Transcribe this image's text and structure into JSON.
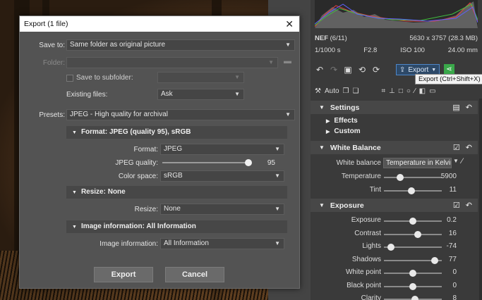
{
  "dialog": {
    "title": "Export (1 file)",
    "close_symbol": "✕",
    "save_to_label": "Save to:",
    "save_to_value": "Same folder as original picture",
    "folder_label": "Folder:",
    "save_to_subfolder_label": "Save to subfolder:",
    "existing_files_label": "Existing files:",
    "existing_files_value": "Ask",
    "presets_label": "Presets:",
    "presets_value": "JPEG - High quality for archival",
    "format_group": {
      "header": "Format: JPEG (quality 95), sRGB",
      "format_label": "Format:",
      "format_value": "JPEG",
      "quality_label": "JPEG quality:",
      "quality_value": "95",
      "quality_fraction": 0.95,
      "color_space_label": "Color space:",
      "color_space_value": "sRGB"
    },
    "resize_group": {
      "header": "Resize: None",
      "resize_label": "Resize:",
      "resize_value": "None"
    },
    "info_group": {
      "header": "Image information: All Information",
      "info_label": "Image information:",
      "info_value": "All Information"
    },
    "export_button": "Export",
    "cancel_button": "Cancel"
  },
  "panel": {
    "file_type": "NEF",
    "file_index": "(6/11)",
    "dimensions": "5630 x 3757 (28.3 MB)",
    "shutter": "1/1000 s",
    "aperture": "F2.8",
    "iso": "ISO 100",
    "focal": "24.00 mm",
    "export_label": "Export",
    "tooltip": "Export (Ctrl+Shift+X)",
    "auto_label": "Auto",
    "sections": {
      "settings": "Settings",
      "effects": "Effects",
      "custom": "Custom",
      "white_balance": "White Balance",
      "exposure": "Exposure"
    },
    "white_balance_label": "White balance",
    "white_balance_value": "Temperature in Kelvin",
    "sliders_wb": [
      {
        "label": "Temperature",
        "value": "5900",
        "pos": 0.28
      },
      {
        "label": "Tint",
        "value": "11",
        "pos": 0.48
      }
    ],
    "sliders_exposure": [
      {
        "label": "Exposure",
        "value": "0.2",
        "pos": 0.5
      },
      {
        "label": "Contrast",
        "value": "16",
        "pos": 0.58
      },
      {
        "label": "Lights",
        "value": "-74",
        "pos": 0.12
      },
      {
        "label": "Shadows",
        "value": "77",
        "pos": 0.88
      },
      {
        "label": "White point",
        "value": "0",
        "pos": 0.5
      },
      {
        "label": "Black point",
        "value": "0",
        "pos": 0.5
      },
      {
        "label": "Clarity",
        "value": "8",
        "pos": 0.54
      }
    ]
  }
}
